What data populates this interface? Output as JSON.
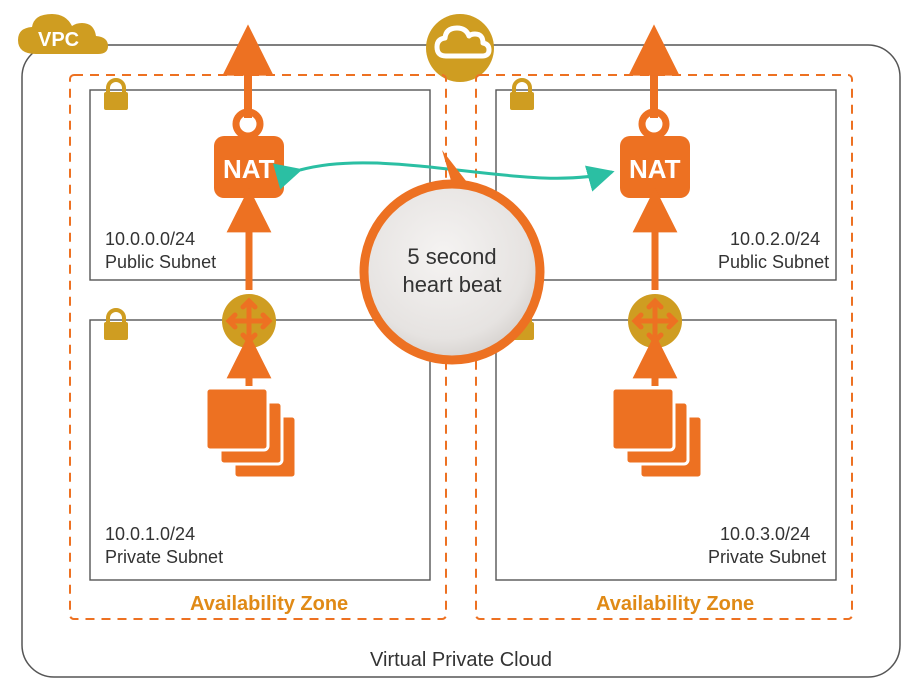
{
  "colors": {
    "orange": "#ed7122",
    "gold": "#cf9d21",
    "teal": "#2bbfa3",
    "border": "#444"
  },
  "vpc": {
    "badge": "VPC",
    "title": "Virtual Private Cloud"
  },
  "heartbeat": {
    "line1": "5 second",
    "line2": "heart beat"
  },
  "nat": {
    "label": "NAT"
  },
  "left": {
    "az_label": "Availability Zone",
    "public": {
      "cidr": "10.0.0.0/24",
      "name": "Public Subnet"
    },
    "private": {
      "cidr": "10.0.1.0/24",
      "name": "Private Subnet"
    }
  },
  "right": {
    "az_label": "Availability Zone",
    "public": {
      "cidr": "10.0.2.0/24",
      "name": "Public Subnet"
    },
    "private": {
      "cidr": "10.0.3.0/24",
      "name": "Private Subnet"
    }
  }
}
